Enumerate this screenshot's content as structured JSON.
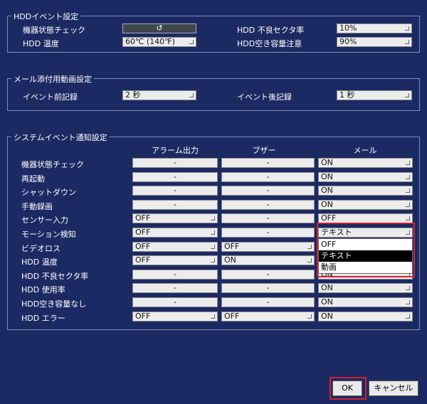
{
  "hdd_event": {
    "title": "HDDイベント設定",
    "device_check_label": "機器状態チェック",
    "device_check_value": "↺",
    "hdd_temp_label": "HDD 温度",
    "hdd_temp_value": "60℃ (140℉)",
    "bad_sector_label": "HDD 不良セクタ率",
    "bad_sector_value": "10%",
    "free_space_label": "HDD空き容量注意",
    "free_space_value": "90%"
  },
  "mail_video": {
    "title": "メール添付用動画設定",
    "pre_label": "イベント前記録",
    "pre_value": "2 秒",
    "post_label": "イベント後記録",
    "post_value": "1 秒"
  },
  "system_event": {
    "title": "システムイベント通知設定",
    "headers": [
      "アラーム出力",
      "ブザー",
      "メール"
    ],
    "rows": [
      {
        "label": "機器状態チェック",
        "alarm": "-",
        "buzzer": "-",
        "mail": "ON"
      },
      {
        "label": "再起動",
        "alarm": "-",
        "buzzer": "-",
        "mail": "ON"
      },
      {
        "label": "シャットダウン",
        "alarm": "-",
        "buzzer": "-",
        "mail": "ON"
      },
      {
        "label": "手動録画",
        "alarm": "-",
        "buzzer": "-",
        "mail": "ON"
      },
      {
        "label": "センサー入力",
        "alarm": "OFF",
        "buzzer": "-",
        "mail": "OFF"
      },
      {
        "label": "モーション検知",
        "alarm": "OFF",
        "buzzer": "-",
        "mail": "テキスト"
      },
      {
        "label": "ビデオロス",
        "alarm": "OFF",
        "buzzer": "OFF",
        "mail": ""
      },
      {
        "label": "HDD 温度",
        "alarm": "OFF",
        "buzzer": "ON",
        "mail": ""
      },
      {
        "label": "HDD 不良セクタ率",
        "alarm": "-",
        "buzzer": "-",
        "mail": "ON"
      },
      {
        "label": "HDD 使用率",
        "alarm": "-",
        "buzzer": "-",
        "mail": "ON"
      },
      {
        "label": "HDD空き容量なし",
        "alarm": "-",
        "buzzer": "-",
        "mail": "ON"
      },
      {
        "label": "HDD エラー",
        "alarm": "OFF",
        "buzzer": "OFF",
        "mail": "ON"
      }
    ],
    "dropdown_options": [
      "OFF",
      "テキスト",
      "動画"
    ],
    "dropdown_selected": "テキスト"
  },
  "buttons": {
    "ok": "OK",
    "cancel": "キャンセル"
  },
  "colors": {
    "background": "#1c2a63",
    "highlight": "#d0202e"
  }
}
